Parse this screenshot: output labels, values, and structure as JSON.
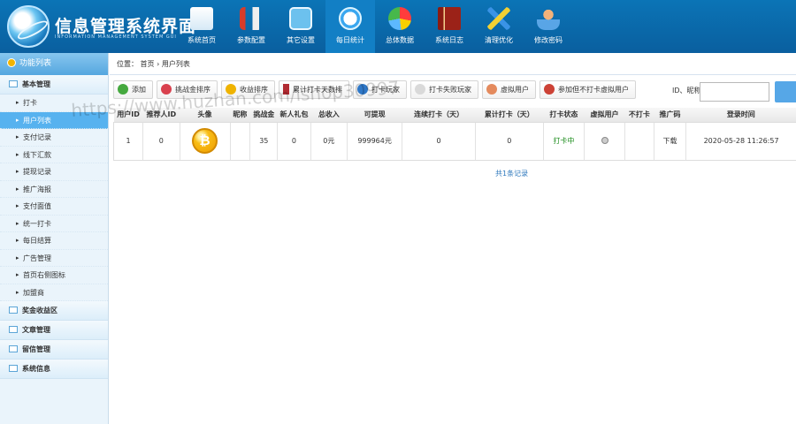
{
  "header": {
    "title": "信息管理系统界面",
    "subtitle": "INFORMATION MANAGEMENT SYSTEM GUI"
  },
  "nav": [
    {
      "label": "系统首页",
      "icon": "home-icon"
    },
    {
      "label": "参数配置",
      "icon": "tools-icon"
    },
    {
      "label": "其它设置",
      "icon": "dialog-icon"
    },
    {
      "label": "每日统计",
      "icon": "clock-icon"
    },
    {
      "label": "总体数据",
      "icon": "pie-chart-icon"
    },
    {
      "label": "系统日志",
      "icon": "book-icon"
    },
    {
      "label": "清理优化",
      "icon": "triangle-icon"
    },
    {
      "label": "修改密码",
      "icon": "user-icon"
    }
  ],
  "sidebar": {
    "title": "功能列表",
    "sections": [
      {
        "label": "基本管理"
      },
      {
        "label": "奖金收益区"
      },
      {
        "label": "文章管理"
      },
      {
        "label": "留信管理"
      },
      {
        "label": "系统信息"
      }
    ],
    "items": [
      {
        "label": "打卡"
      },
      {
        "label": "用户列表"
      },
      {
        "label": "支付记录"
      },
      {
        "label": "线下汇款"
      },
      {
        "label": "提现记录"
      },
      {
        "label": "推广海报"
      },
      {
        "label": "支付面值"
      },
      {
        "label": "统一打卡"
      },
      {
        "label": "每日结算"
      },
      {
        "label": "广告管理"
      },
      {
        "label": "首页右侧图标"
      },
      {
        "label": "加盟商"
      }
    ]
  },
  "breadcrumb": {
    "prefix": "位置：",
    "home": "首页",
    "separator": "›",
    "current": "用户列表"
  },
  "toolbar": [
    {
      "label": "添加",
      "icon": "plus-icon"
    },
    {
      "label": "挑战金排序",
      "icon": "sort-icon"
    },
    {
      "label": "收益排序",
      "icon": "coin-icon"
    },
    {
      "label": "累计打卡天数排",
      "icon": "sort-bars-icon"
    },
    {
      "label": "打卡玩家",
      "icon": "users-icon"
    },
    {
      "label": "打卡失败玩家",
      "icon": "user-fail-icon"
    },
    {
      "label": "虚拟用户",
      "icon": "virtual-user-icon"
    },
    {
      "label": "参加但不打卡虚拟用户",
      "icon": "warning-user-icon"
    }
  ],
  "search": {
    "label": "ID、昵称：",
    "value": "",
    "placeholder": ""
  },
  "table": {
    "headers": [
      "用户ID",
      "推荐人ID",
      "头像",
      "昵称",
      "挑战金",
      "新人礼包",
      "总收入",
      "可提现",
      "连续打卡（天）",
      "累计打卡（天）",
      "打卡状态",
      "虚拟用户",
      "不打卡",
      "推广码",
      "登录时间"
    ],
    "rows": [
      {
        "user_id": "1",
        "referrer_id": "0",
        "avatar_icon": "bitcoin-avatar-icon",
        "nickname": "",
        "challenge": "35",
        "newbie": "0",
        "income": "0元",
        "withdrawable": "999964元",
        "continuous": "0",
        "cumulative": "0",
        "status": "打卡中",
        "virtual": "",
        "no_checkin": "",
        "promo": "下载",
        "login_time": "2020-05-28 11:26:57"
      }
    ]
  },
  "total": "共1条记录",
  "watermark": "https://www.huzhan.com/ishop30997"
}
